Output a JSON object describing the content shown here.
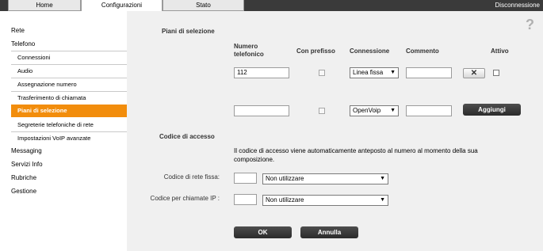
{
  "tabs": [
    {
      "label": "Home"
    },
    {
      "label": "Configurazioni"
    },
    {
      "label": "Stato"
    }
  ],
  "logout_label": "Disconnessione",
  "sidebar": {
    "items": [
      {
        "label": "Rete",
        "level": 1
      },
      {
        "label": "Telefono",
        "level": 1
      },
      {
        "label": "Connessioni",
        "level": 2
      },
      {
        "label": "Audio",
        "level": 2
      },
      {
        "label": "Assegnazione numero",
        "level": 2
      },
      {
        "label": "Trasferimento di chiamata",
        "level": 2
      },
      {
        "label": "Piani di selezione",
        "level": 2,
        "active": true
      },
      {
        "label": "Segreterie telefoniche di rete",
        "level": 2
      },
      {
        "label": "Impostazioni VoIP avanzate",
        "level": 2
      },
      {
        "label": "Messaging",
        "level": 1
      },
      {
        "label": "Servizi Info",
        "level": 1
      },
      {
        "label": "Rubriche",
        "level": 1
      },
      {
        "label": "Gestione",
        "level": 1
      }
    ]
  },
  "help_icon": "?",
  "dial_plans": {
    "section_title": "Piani di selezione",
    "columns": {
      "number": "Numero telefonico",
      "prefix": "Con prefisso",
      "connection": "Connessione",
      "comment": "Commento",
      "active": "Attivo"
    },
    "rows": [
      {
        "number": "112",
        "prefix": false,
        "connection": "Linea fissa",
        "comment": "",
        "delete_icon": "close-icon",
        "active": false
      },
      {
        "number": "",
        "prefix": false,
        "connection": "OpenVoip",
        "comment": "",
        "add_label": "Aggiungi"
      }
    ]
  },
  "access_code": {
    "section_title": "Codice di accesso",
    "description": "Il codice di accesso viene automaticamente anteposto al numero al momento della sua composizione.",
    "fields": [
      {
        "label": "Codice di rete fissa:",
        "code": "",
        "option": "Non utilizzare"
      },
      {
        "label": "Codice per chiamate IP :",
        "code": "",
        "option": "Non utilizzare"
      }
    ]
  },
  "buttons": {
    "ok": "OK",
    "cancel": "Annulla"
  },
  "colors": {
    "accent": "#f28d0c",
    "topbar": "#3a3a3a",
    "content_bg": "#f0f0f0"
  }
}
